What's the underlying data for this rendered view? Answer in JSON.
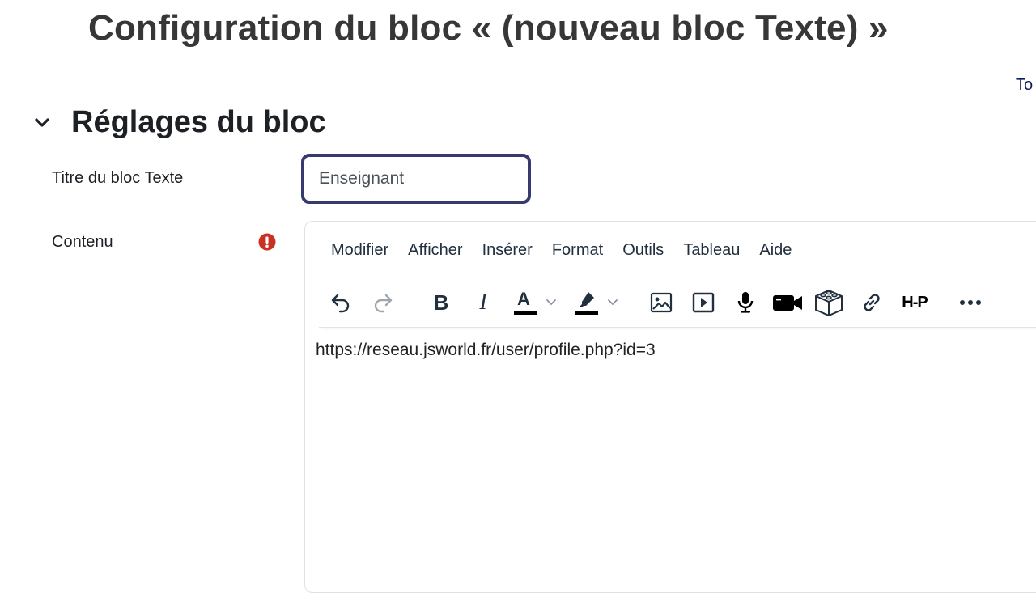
{
  "page": {
    "title": "Configuration du bloc « (nouveau bloc Texte) »",
    "expand_all_label": "To"
  },
  "section": {
    "title": "Réglages du bloc",
    "toggle_icon": "chevron-down-icon"
  },
  "form": {
    "block_title_label": "Titre du bloc Texte",
    "block_title_value": "Enseignant",
    "content_label": "Contenu",
    "required_icon": "exclamation-circle-icon",
    "required_color": "#ca3120"
  },
  "editor": {
    "menu": [
      "Modifier",
      "Afficher",
      "Insérer",
      "Format",
      "Outils",
      "Tableau",
      "Aide"
    ],
    "toolbar": {
      "undo": "undo-icon",
      "redo": "redo-icon",
      "bold": "B",
      "italic": "I",
      "text_color": "A",
      "highlight": "highlighter-icon",
      "image": "image-icon",
      "media": "media-icon",
      "record_audio": "microphone-icon",
      "record_video": "video-camera-icon",
      "content_bank": "cube-icon",
      "link": "link-icon",
      "h5p": "H-P",
      "more": "more-icon"
    },
    "content": "https://reseau.jsworld.fr/user/profile.php?id=3"
  },
  "colors": {
    "input_focus_border": "#363a6e",
    "text_primary": "#1d2125",
    "link": "#0f1a5a"
  }
}
